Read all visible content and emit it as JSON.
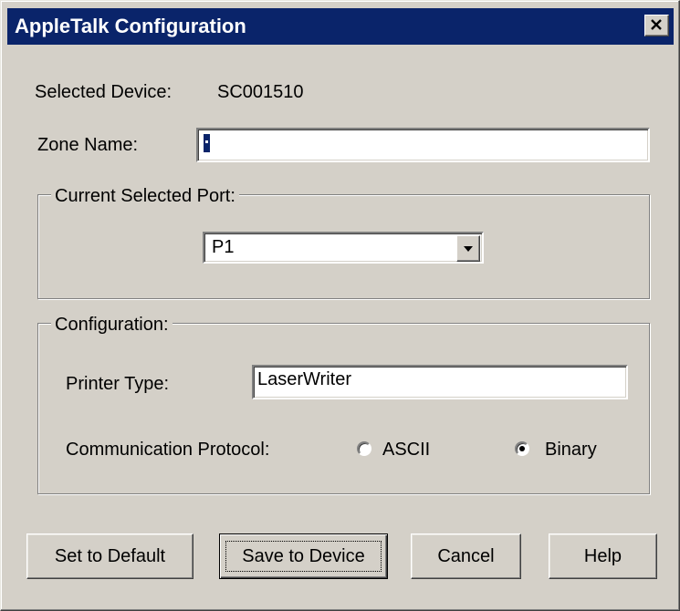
{
  "window": {
    "title": "AppleTalk Configuration",
    "close_icon": "close-icon"
  },
  "device": {
    "label": "Selected Device:",
    "value": "SC001510"
  },
  "zone": {
    "label": "Zone Name:",
    "value": ""
  },
  "port_group": {
    "legend": "Current Selected Port:",
    "selected": "P1",
    "dropdown_icon": "chevron-down-icon"
  },
  "config_group": {
    "legend": "Configuration:",
    "printer_type_label": "Printer Type:",
    "printer_type_value": "LaserWriter",
    "protocol_label": "Communication Protocol:",
    "options": [
      {
        "label": "ASCII",
        "selected": false
      },
      {
        "label": "Binary",
        "selected": true
      }
    ]
  },
  "buttons": {
    "set_default": "Set to Default",
    "save": "Save to Device",
    "cancel": "Cancel",
    "help": "Help"
  },
  "colors": {
    "titlebar": "#0a246a",
    "face": "#d4d0c8"
  }
}
